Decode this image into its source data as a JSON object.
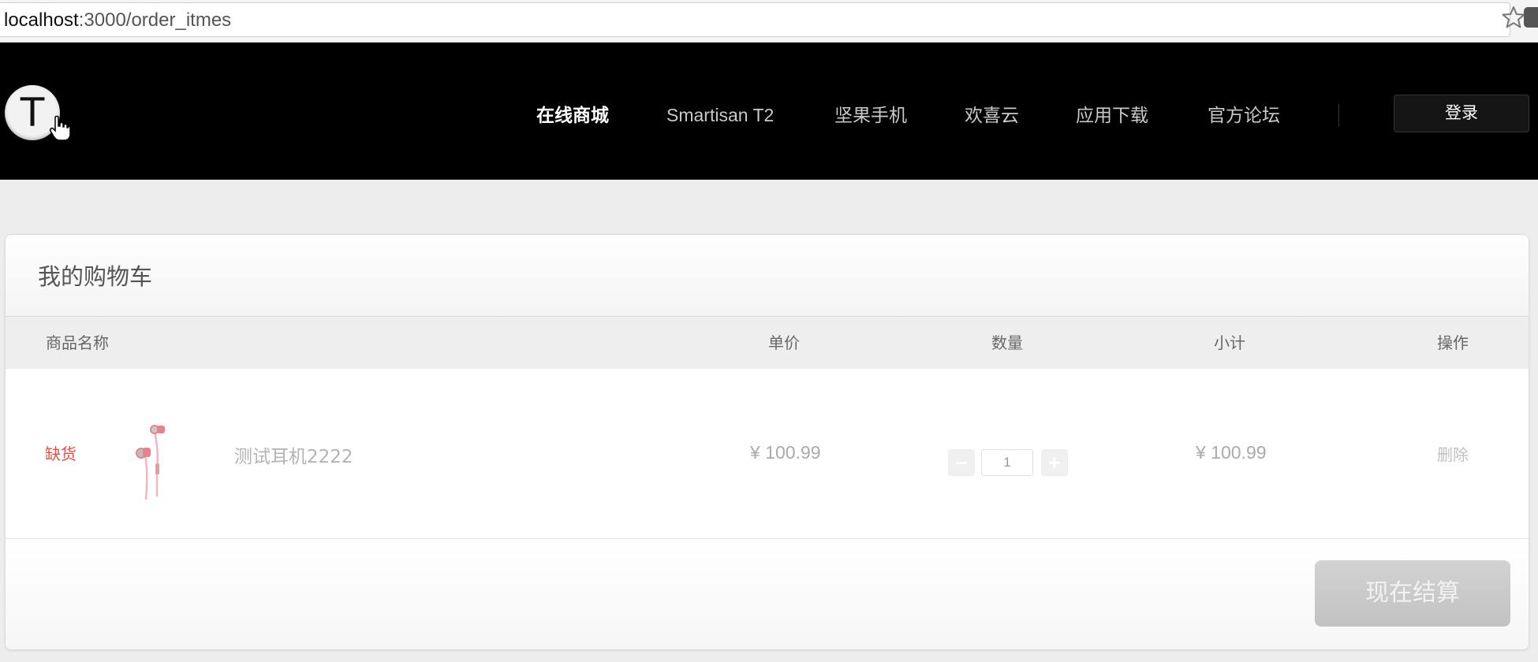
{
  "browser": {
    "url_host": "localhost",
    "url_path": ":3000/order_itmes"
  },
  "header": {
    "logo_letter": "T",
    "nav": [
      {
        "label": "在线商城",
        "active": true
      },
      {
        "label": "Smartisan T2",
        "active": false
      },
      {
        "label": "坚果手机",
        "active": false
      },
      {
        "label": "欢喜云",
        "active": false
      },
      {
        "label": "应用下载",
        "active": false
      },
      {
        "label": "官方论坛",
        "active": false
      }
    ],
    "login_label": "登录"
  },
  "cart": {
    "title": "我的购物车",
    "columns": {
      "name": "商品名称",
      "unit_price": "单价",
      "quantity": "数量",
      "subtotal": "小计",
      "action": "操作"
    },
    "items": [
      {
        "status": "缺货",
        "name": "测试耳机2222",
        "unit_price": "¥ 100.99",
        "quantity": "1",
        "subtotal": "¥ 100.99",
        "delete_label": "删除"
      }
    ],
    "decrement_label": "−",
    "increment_label": "+",
    "checkout_label": "现在结算"
  },
  "colors": {
    "header_bg": "#000000",
    "out_of_stock": "#d9534f",
    "checkout_disabled": "#c8c8c8"
  },
  "icons": [
    "star-icon",
    "extension-icon",
    "hand-cursor-icon",
    "earphone-image"
  ]
}
